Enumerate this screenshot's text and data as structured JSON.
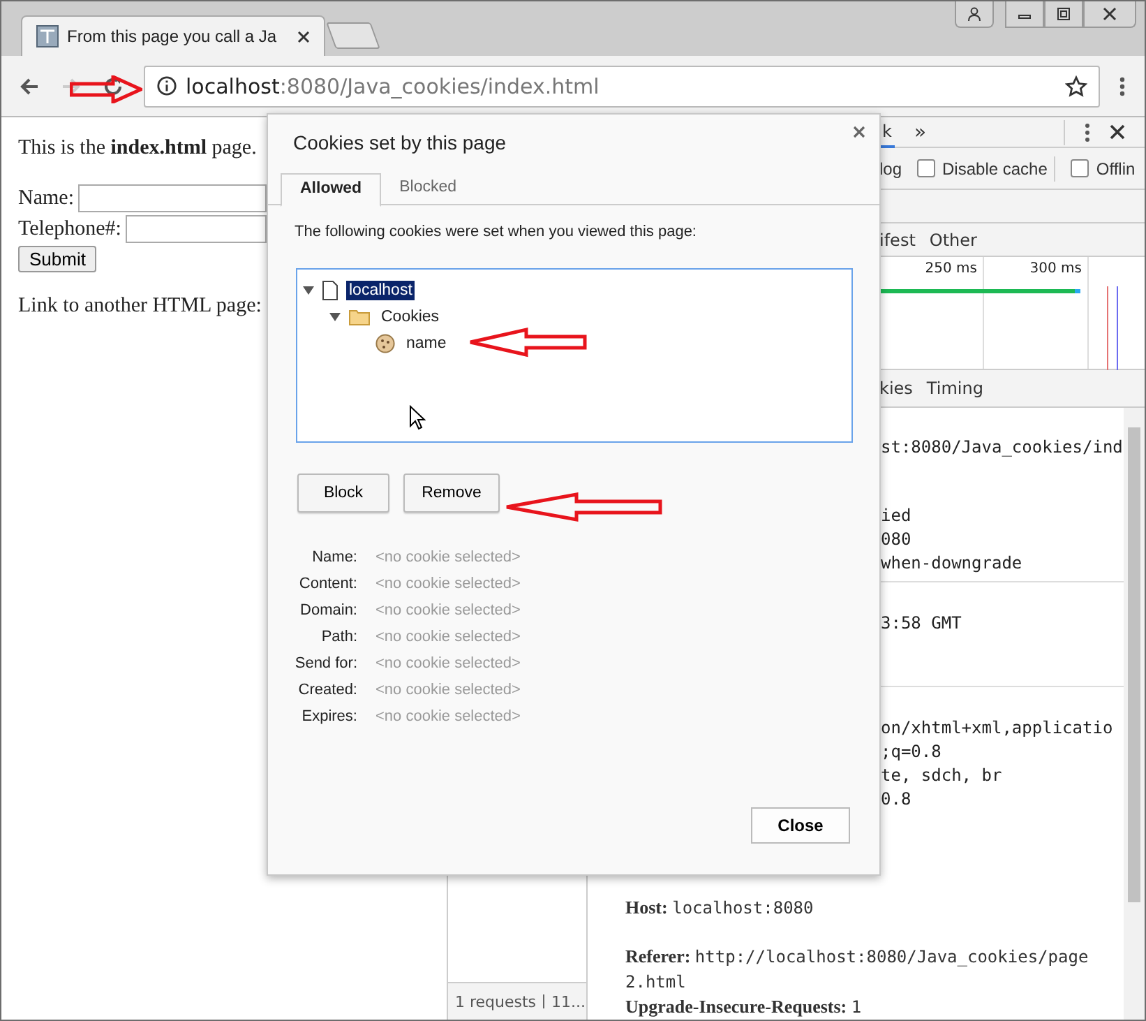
{
  "browser": {
    "tab_title": "From this page you call a Ja",
    "address": {
      "host": "localhost",
      "path": ":8080/Java_cookies/index.html"
    }
  },
  "page": {
    "intro": "This is the **index.html** page.",
    "fields": [
      {
        "label": "Name:"
      },
      {
        "label": "Telephone#:"
      }
    ],
    "submit": "Submit",
    "link_text": "Link to another HTML page:"
  },
  "devtools": {
    "tabs": [
      {
        "label": "k",
        "selected": true
      }
    ],
    "more": "»",
    "filters": {
      "log_fragment": "log",
      "checkboxes": [
        {
          "label": "Disable cache",
          "checked": false
        },
        {
          "label": "Offlin",
          "checked": false
        }
      ]
    },
    "type_filters": [
      "ifest",
      "Other"
    ],
    "timeline": {
      "ticks": [
        "250 ms",
        "300 ms"
      ]
    },
    "detail_tabs": [
      "kies",
      "Timing"
    ],
    "header_blocks": [
      [
        "st:8080/Java_cookies/ind"
      ],
      [
        "ied",
        "080",
        "when-downgrade"
      ],
      [
        "3:58 GMT"
      ],
      [
        "on/xhtml+xml,applicatio",
        ";q=0.8",
        "te, sdch, br",
        "0.8"
      ]
    ],
    "request_headers": [
      {
        "key": "Host:",
        "value": "localhost:8080"
      },
      {
        "key": "Referer:",
        "value": "http://localhost:8080/Java_cookies/page2.html"
      },
      {
        "key": "Upgrade-Insecure-Requests:",
        "value": "1"
      }
    ],
    "status": [
      "1 requests",
      "11..."
    ]
  },
  "dialog": {
    "title": "Cookies set by this page",
    "tabs": [
      {
        "label": "Allowed",
        "selected": true
      },
      {
        "label": "Blocked",
        "selected": false
      }
    ],
    "intro": "The following cookies were set when you viewed this page:",
    "tree": [
      {
        "label": "localhost",
        "kind": "site",
        "expanded": true,
        "selected": true,
        "children": [
          {
            "label": "Cookies",
            "kind": "folder",
            "expanded": true,
            "selected": false,
            "children": [
              {
                "label": "name",
                "kind": "cookie",
                "selected": false
              }
            ]
          }
        ]
      }
    ],
    "buttons": [
      "Block",
      "Remove"
    ],
    "details": [
      {
        "label": "Name:",
        "value": "<no cookie selected>"
      },
      {
        "label": "Content:",
        "value": "<no cookie selected>"
      },
      {
        "label": "Domain:",
        "value": "<no cookie selected>"
      },
      {
        "label": "Path:",
        "value": "<no cookie selected>"
      },
      {
        "label": "Send for:",
        "value": "<no cookie selected>"
      },
      {
        "label": "Created:",
        "value": "<no cookie selected>"
      },
      {
        "label": "Expires:",
        "value": "<no cookie selected>"
      }
    ],
    "close": "Close"
  }
}
